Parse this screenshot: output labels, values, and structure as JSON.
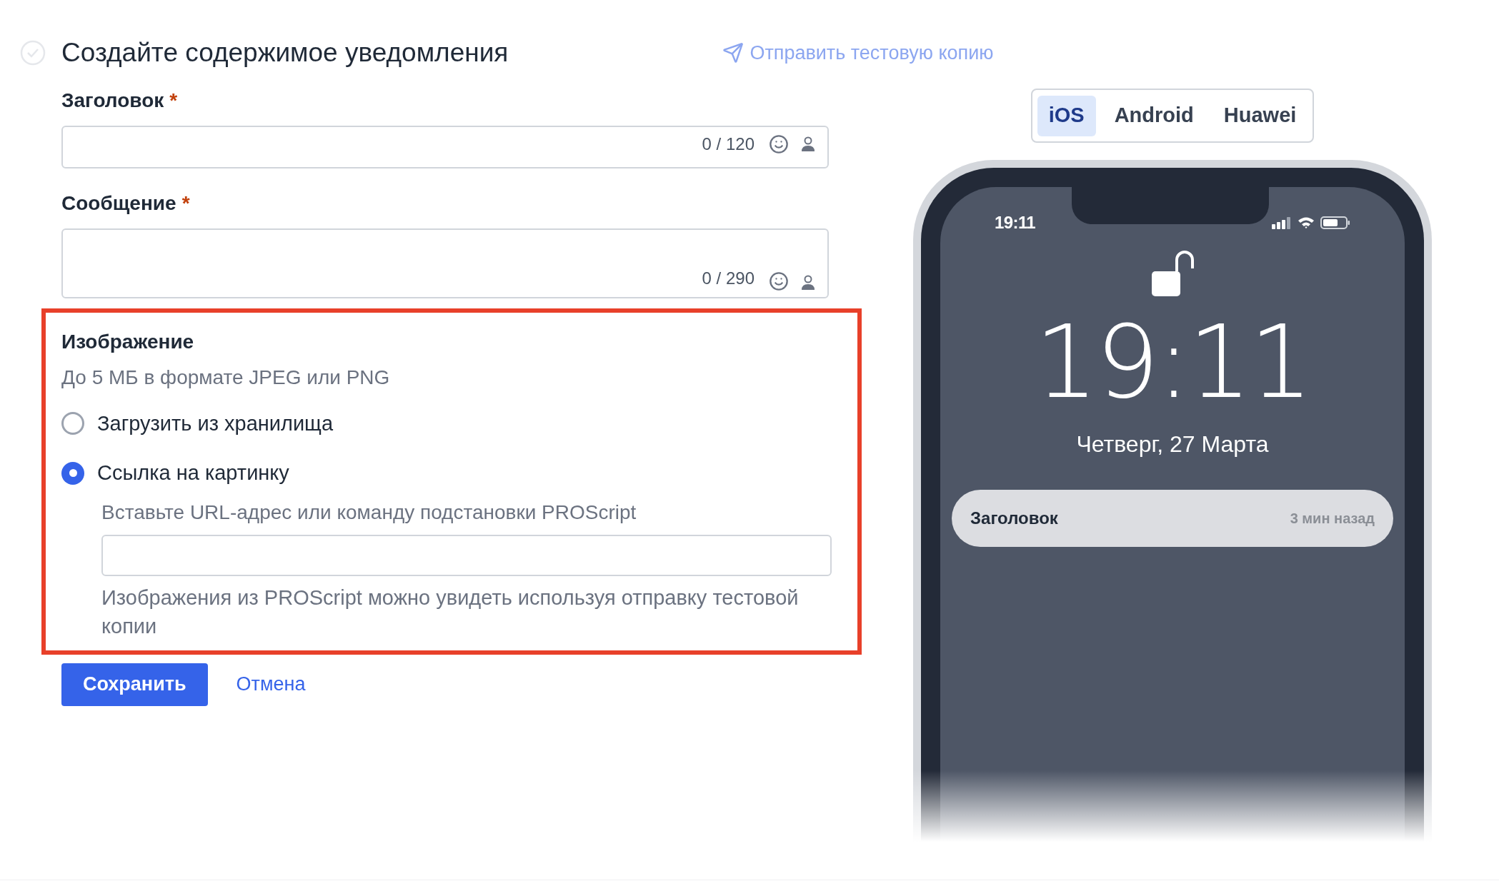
{
  "header": {
    "title": "Создайте содержимое уведомления",
    "test_link": "Отправить тестовую копию"
  },
  "fields": [
    {
      "kind": "single",
      "label": "Заголовок",
      "required_mark": "*",
      "counter": "0 / 120"
    },
    {
      "kind": "multi",
      "label": "Сообщение",
      "required_mark": "*",
      "counter": "0 / 290"
    }
  ],
  "image_section": {
    "title": "Изображение",
    "hint": "До 5 МБ в формате JPEG или PNG",
    "options": [
      {
        "label": "Загрузить из хранилища",
        "selected": false
      },
      {
        "label": "Ссылка на картинку",
        "selected": true
      }
    ],
    "url_label": "Вставьте URL-адрес или команду подстановки PROScript",
    "note": "Изображения из PROScript можно увидеть используя отправку тестовой копии"
  },
  "actions": {
    "save": "Сохранить",
    "cancel": "Отмена"
  },
  "preview": {
    "tabs": [
      {
        "label": "iOS",
        "selected": true
      },
      {
        "label": "Android",
        "selected": false
      },
      {
        "label": "Huawei",
        "selected": false
      }
    ],
    "status_time": "19:11",
    "clock": "19:11",
    "date": "Четверг, 27 Марта",
    "notification": {
      "title": "Заголовок",
      "time": "3 мин назад"
    }
  }
}
